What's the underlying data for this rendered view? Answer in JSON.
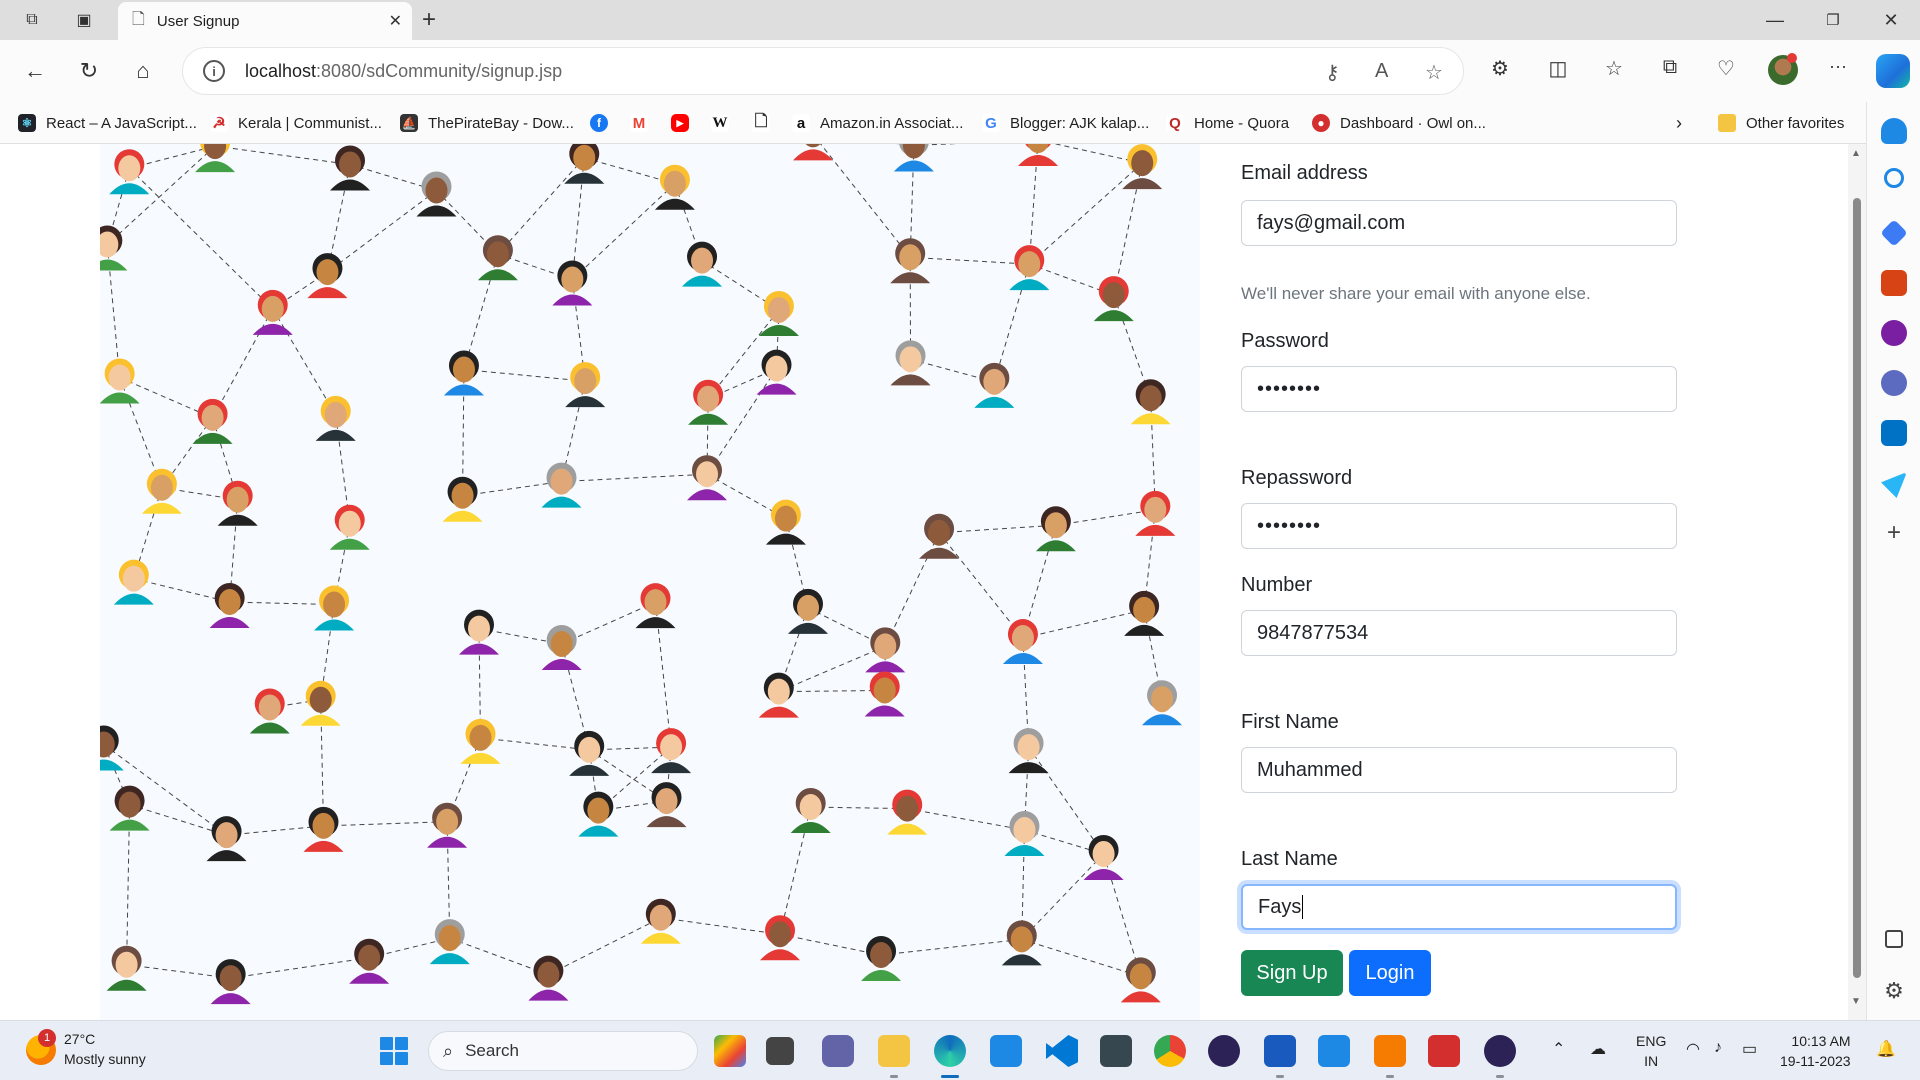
{
  "browser": {
    "tab_title": "User Signup",
    "url_host": "localhost",
    "url_rest": ":8080/sdCommunity/signup.jsp",
    "favorites": [
      {
        "label": "React – A JavaScript...",
        "color": "#20232a"
      },
      {
        "label": "Kerala | Communist...",
        "color": "#d32f2f"
      },
      {
        "label": "ThePirateBay - Dow...",
        "color": "#333333"
      },
      {
        "label": "",
        "color": "#1877f2"
      },
      {
        "label": "",
        "color": "#ea4335"
      },
      {
        "label": "",
        "color": "#ff0000"
      },
      {
        "label": "W",
        "color": "#ffffff"
      },
      {
        "label": "",
        "color": "#ffffff"
      },
      {
        "label": "Amazon.in Associat...",
        "color": "#111111"
      },
      {
        "label": "Blogger: AJK kalap...",
        "color": "#ffffff"
      },
      {
        "label": "Home - Quora",
        "color": "#b92b27"
      },
      {
        "label": "Dashboard · Owl on...",
        "color": "#d32f2f"
      }
    ],
    "other_favorites": "Other favorites"
  },
  "form": {
    "email_label": "Email address",
    "email_value": "fays@gmail.com",
    "email_help": "We'll never share your email with anyone else.",
    "password_label": "Password",
    "password_value": "••••••••",
    "repassword_label": "Repassword",
    "repassword_value": "••••••••",
    "number_label": "Number",
    "number_value": "9847877534",
    "firstname_label": "First Name",
    "firstname_value": "Muhammed",
    "lastname_label": "Last Name",
    "lastname_value": "Fays",
    "signup_label": "Sign Up",
    "login_label": "Login",
    "colors": {
      "signup": "#198754",
      "login": "#0d6efd",
      "focus": "#86b7fe"
    }
  },
  "taskbar": {
    "weather_temp": "27°C",
    "weather_desc": "Mostly sunny",
    "weather_badge": "1",
    "search_label": "Search",
    "lang_top": "ENG",
    "lang_bottom": "IN",
    "time": "10:13 AM",
    "date": "19-11-2023"
  }
}
